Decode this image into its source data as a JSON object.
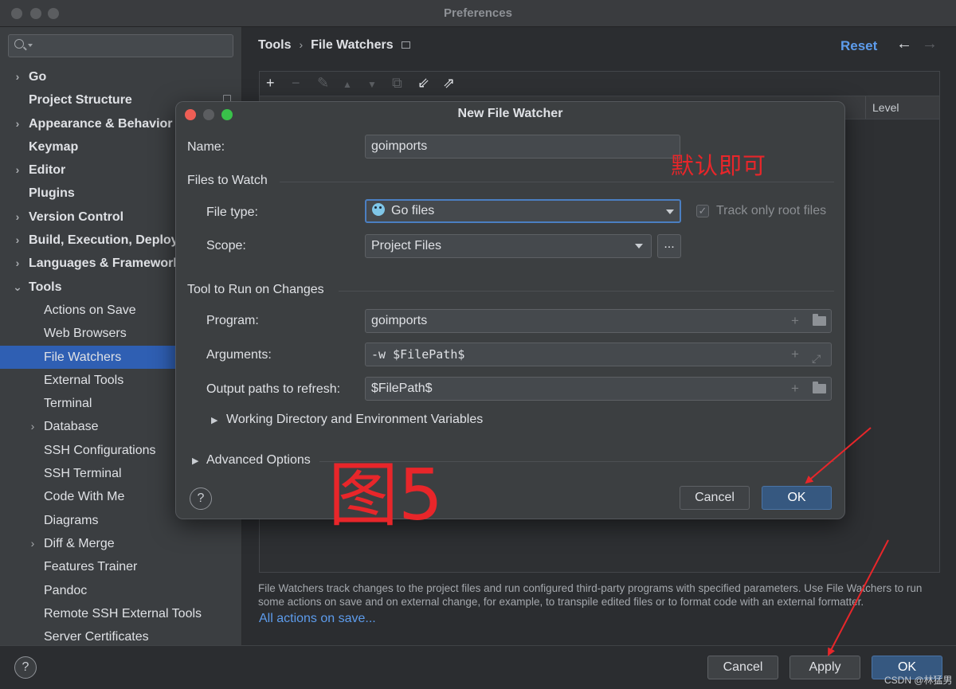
{
  "window": {
    "title": "Preferences"
  },
  "sidebar": {
    "search_placeholder": "",
    "items": [
      {
        "label": "Go",
        "arrow": "›"
      },
      {
        "label": "Project Structure"
      },
      {
        "label": "Appearance & Behavior",
        "arrow": "›"
      },
      {
        "label": "Keymap"
      },
      {
        "label": "Editor",
        "arrow": "›"
      },
      {
        "label": "Plugins"
      },
      {
        "label": "Version Control",
        "arrow": "›"
      },
      {
        "label": "Build, Execution, Deployment",
        "arrow": "›"
      },
      {
        "label": "Languages & Frameworks",
        "arrow": "›"
      },
      {
        "label": "Tools",
        "arrow": "⌄"
      },
      {
        "label": "Actions on Save"
      },
      {
        "label": "Web Browsers"
      },
      {
        "label": "File Watchers"
      },
      {
        "label": "External Tools"
      },
      {
        "label": "Terminal"
      },
      {
        "label": "Database",
        "arrow": "›"
      },
      {
        "label": "SSH Configurations"
      },
      {
        "label": "SSH Terminal"
      },
      {
        "label": "Code With Me"
      },
      {
        "label": "Diagrams"
      },
      {
        "label": "Diff & Merge",
        "arrow": "›"
      },
      {
        "label": "Features Trainer"
      },
      {
        "label": "Pandoc"
      },
      {
        "label": "Remote SSH External Tools"
      },
      {
        "label": "Server Certificates"
      }
    ]
  },
  "content": {
    "breadcrumb": [
      "Tools",
      "File Watchers"
    ],
    "breadcrumb_sep": "›",
    "reset": "Reset",
    "nav_back": "←",
    "nav_forward": "→",
    "toolbar": {
      "add": "+",
      "remove": "−",
      "edit": "✎",
      "up": "▲",
      "down": "▼",
      "copy": "⧉",
      "import": "⇙",
      "export": "⇗"
    },
    "table_columns": [
      "Level"
    ],
    "description": "File Watchers track changes to the project files and run configured third-party programs with specified parameters. Use File Watchers to run some actions on save and on external change, for example, to transpile edited files or to format code with an external formatter.",
    "link": "All actions on save..."
  },
  "footer": {
    "help": "?",
    "cancel": "Cancel",
    "apply": "Apply",
    "ok": "OK"
  },
  "dialog": {
    "title": "New File Watcher",
    "name_label": "Name:",
    "name_value": "goimports",
    "files_to_watch": "Files to Watch",
    "file_type_label": "File type:",
    "file_type_value": "Go files",
    "track_root_label": "Track only root files",
    "track_root_checked": "✓",
    "scope_label": "Scope:",
    "scope_value": "Project Files",
    "scope_more": "...",
    "tool_section": "Tool to Run on Changes",
    "program_label": "Program:",
    "program_value": "goimports",
    "arguments_label": "Arguments:",
    "arguments_value": "-w $FilePath$",
    "output_label": "Output paths to refresh:",
    "output_value": "$FilePath$",
    "plus": "+",
    "expand": "⤢",
    "working_dir": "Working Directory and Environment Variables",
    "advanced": "Advanced Options",
    "expander": "▶",
    "help": "?",
    "cancel": "Cancel",
    "ok": "OK"
  },
  "annotations": {
    "default_ok": "默认即可",
    "figure": "图5",
    "watermark": "CSDN @林猛男",
    "color": "#e8262a"
  }
}
